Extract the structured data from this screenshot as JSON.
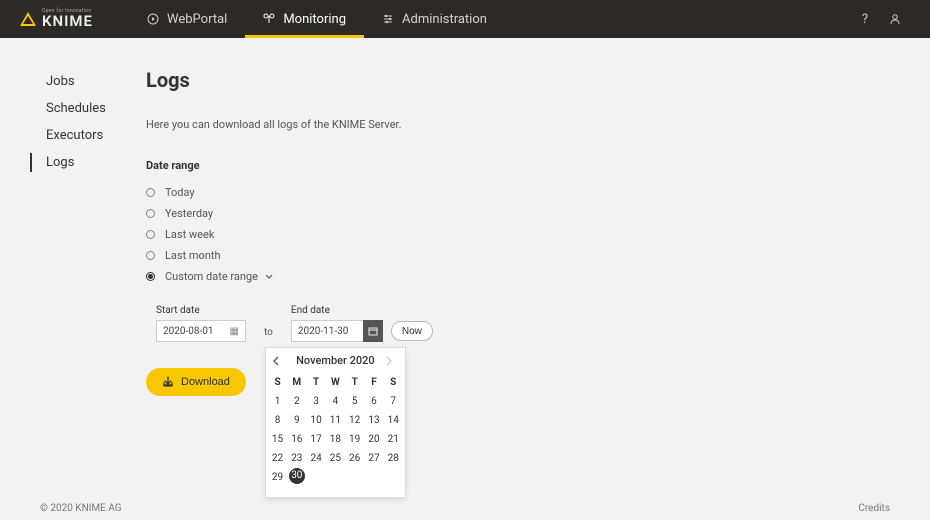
{
  "brand": {
    "tagline": "Open for Innovation",
    "name": "KNIME"
  },
  "topnav": {
    "items": [
      {
        "label": "WebPortal",
        "icon": "play",
        "active": false
      },
      {
        "label": "Monitoring",
        "icon": "monitor",
        "active": true
      },
      {
        "label": "Administration",
        "icon": "admin",
        "active": false
      }
    ]
  },
  "sidebar": {
    "items": [
      {
        "label": "Jobs",
        "active": false
      },
      {
        "label": "Schedules",
        "active": false
      },
      {
        "label": "Executors",
        "active": false
      },
      {
        "label": "Logs",
        "active": true
      }
    ]
  },
  "page": {
    "title": "Logs",
    "description": "Here you can download all logs of the KNIME Server."
  },
  "date_range": {
    "section_label": "Date range",
    "options": [
      {
        "label": "Today",
        "selected": false
      },
      {
        "label": "Yesterday",
        "selected": false
      },
      {
        "label": "Last week",
        "selected": false
      },
      {
        "label": "Last month",
        "selected": false
      },
      {
        "label": "Custom date range",
        "selected": true,
        "chevron": true
      }
    ],
    "start": {
      "label": "Start date",
      "value": "2020-08-01"
    },
    "to_label": "to",
    "end": {
      "label": "End date",
      "value": "2020-11-30"
    },
    "now_label": "Now"
  },
  "download_label": "Download",
  "calendar": {
    "title": "November 2020",
    "dow": [
      "S",
      "M",
      "T",
      "W",
      "T",
      "F",
      "S"
    ],
    "weeks": [
      [
        "1",
        "2",
        "3",
        "4",
        "5",
        "6",
        "7"
      ],
      [
        "8",
        "9",
        "10",
        "11",
        "12",
        "13",
        "14"
      ],
      [
        "15",
        "16",
        "17",
        "18",
        "19",
        "20",
        "21"
      ],
      [
        "22",
        "23",
        "24",
        "25",
        "26",
        "27",
        "28"
      ],
      [
        "29",
        "30",
        "",
        "",
        "",
        "",
        ""
      ]
    ],
    "selected": "30"
  },
  "footer": {
    "copyright": "© 2020 KNIME AG",
    "credits": "Credits"
  }
}
